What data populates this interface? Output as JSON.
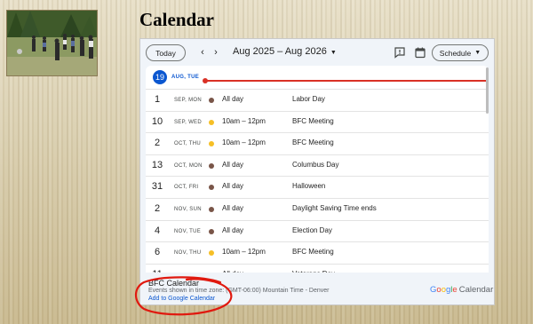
{
  "page": {
    "title": "Calendar"
  },
  "photo": {
    "alt": "group of people standing in a forest clearing"
  },
  "calendar": {
    "toolbar": {
      "today_label": "Today",
      "prev_icon": "chevron-left-icon",
      "next_icon": "chevron-right-icon",
      "range_label": "Aug 2025 – Aug 2026",
      "feedback_icon": "feedback-icon",
      "calendar_icon": "calendar-icon",
      "view_label": "Schedule"
    },
    "today": {
      "day": "19",
      "label": "AUG, TUE"
    },
    "colors": {
      "today_accent": "#0b57d0",
      "now_line": "#d93025",
      "dot_brown": "#795548",
      "dot_yellow": "#f6bf26"
    },
    "events": [
      {
        "day": "1",
        "label": "SEP, MON",
        "time": "All day",
        "title": "Labor Day",
        "dot": "brown"
      },
      {
        "day": "10",
        "label": "SEP, WED",
        "time": "10am – 12pm",
        "title": "BFC Meeting",
        "dot": "yellow"
      },
      {
        "day": "2",
        "label": "OCT, THU",
        "time": "10am – 12pm",
        "title": "BFC Meeting",
        "dot": "yellow"
      },
      {
        "day": "13",
        "label": "OCT, MON",
        "time": "All day",
        "title": "Columbus Day",
        "dot": "brown"
      },
      {
        "day": "31",
        "label": "OCT, FRI",
        "time": "All day",
        "title": "Halloween",
        "dot": "brown"
      },
      {
        "day": "2",
        "label": "NOV, SUN",
        "time": "All day",
        "title": "Daylight Saving Time ends",
        "dot": "brown"
      },
      {
        "day": "4",
        "label": "NOV, TUE",
        "time": "All day",
        "title": "Election Day",
        "dot": "brown"
      },
      {
        "day": "6",
        "label": "NOV, THU",
        "time": "10am – 12pm",
        "title": "BFC Meeting",
        "dot": "yellow"
      },
      {
        "day": "11",
        "label": "NOV, TUE",
        "time": "All day",
        "title": "Veterans Day",
        "dot": "brown"
      }
    ],
    "footer": {
      "calendar_name": "BFC Calendar",
      "timezone": "Events shown in time zone: (GMT-06:00) Mountain Time - Denver",
      "add_link": "Add to Google Calendar",
      "logo_google": "Google",
      "logo_calendar": "Calendar"
    }
  },
  "annotation": {
    "shape": "hand-drawn-red-circle",
    "color": "#e0190f"
  }
}
